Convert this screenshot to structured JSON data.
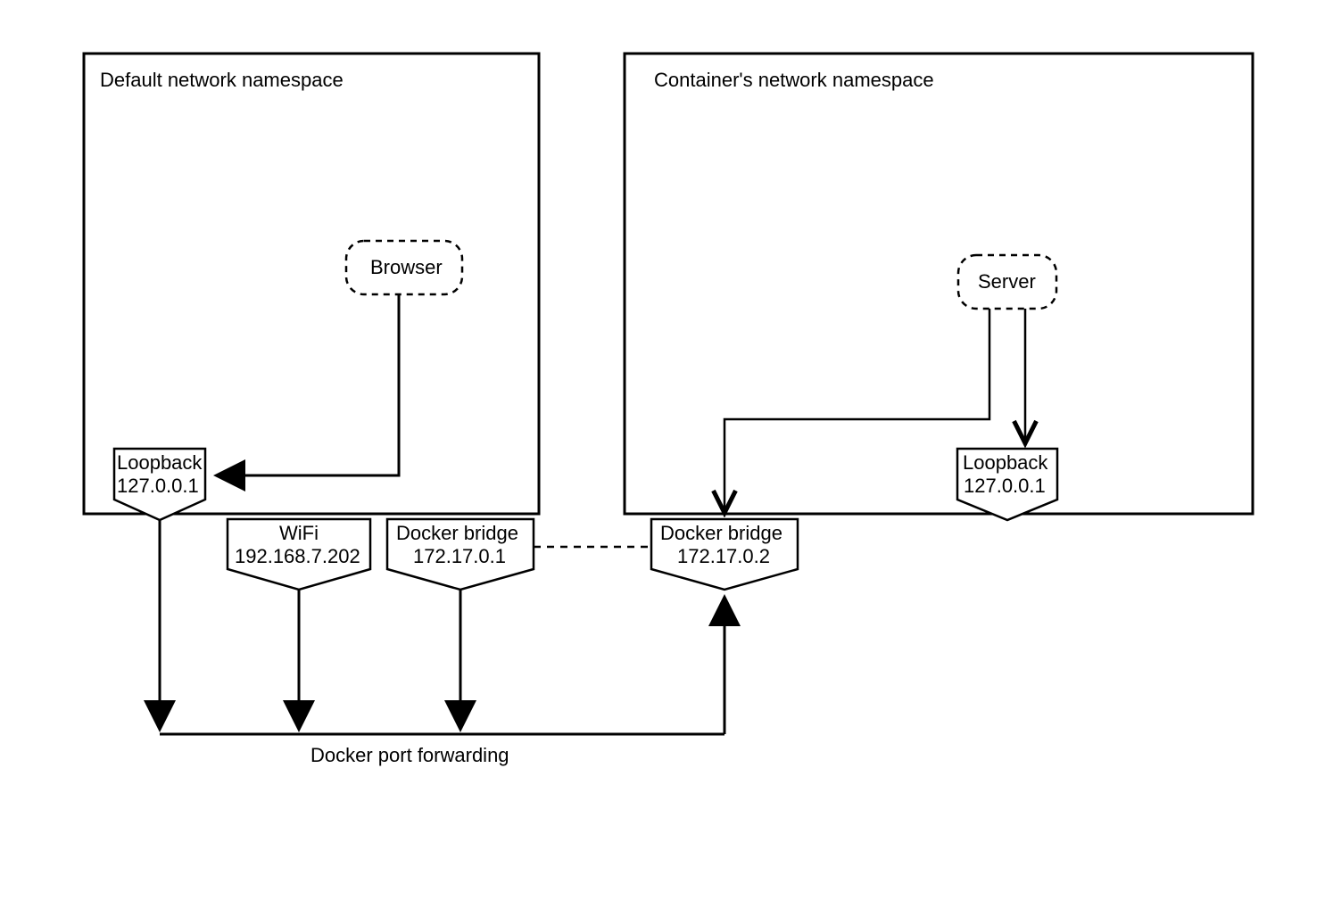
{
  "namespaces": {
    "default": {
      "title": "Default network namespace"
    },
    "container": {
      "title": "Container's network namespace"
    }
  },
  "processes": {
    "browser": {
      "label": "Browser"
    },
    "server": {
      "label": "Server"
    }
  },
  "interfaces": {
    "default_loopback": {
      "label": "Loopback",
      "ip": "127.0.0.1"
    },
    "wifi": {
      "label": "WiFi",
      "ip": "192.168.7.202"
    },
    "default_docker_bridge": {
      "label": "Docker bridge",
      "ip": "172.17.0.1"
    },
    "container_docker_bridge": {
      "label": "Docker bridge",
      "ip": "172.17.0.2"
    },
    "container_loopback": {
      "label": "Loopback",
      "ip": "127.0.0.1"
    }
  },
  "port_forwarding": {
    "label": "Docker port forwarding"
  }
}
